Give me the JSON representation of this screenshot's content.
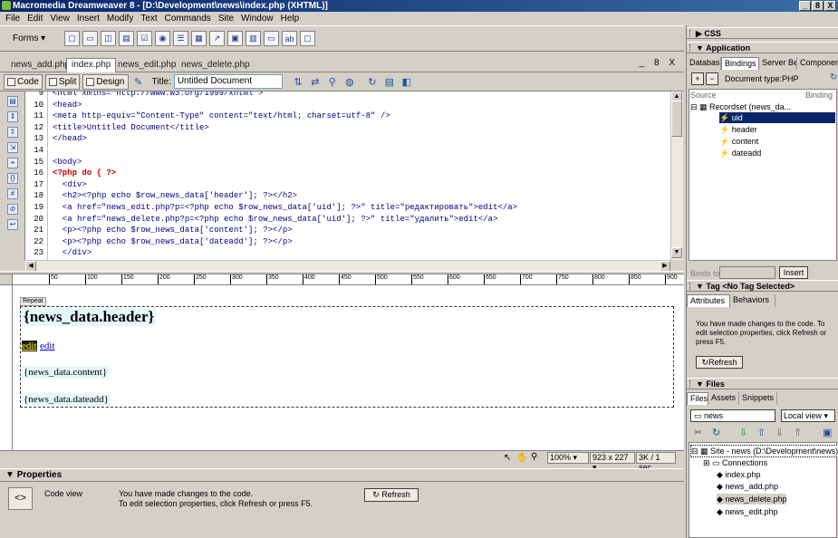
{
  "window": {
    "title": "Macromedia Dreamweaver 8 - [D:\\Development\\news\\index.php (XHTML)]",
    "controls": [
      "_",
      "8",
      "X"
    ]
  },
  "menu": [
    "File",
    "Edit",
    "View",
    "Insert",
    "Modify",
    "Text",
    "Commands",
    "Site",
    "Window",
    "Help"
  ],
  "insert_bar": {
    "category": "Forms"
  },
  "doc_tabs": [
    "news_add.php",
    "index.php",
    "news_edit.php",
    "news_delete.php"
  ],
  "doc_tab_controls": "_ 8 X",
  "doc_toolbar": {
    "code_label": "Code",
    "split_label": "Split",
    "design_label": "Design",
    "title_label": "Title:",
    "title_value": "Untitled Document"
  },
  "code": {
    "line_numbers": [
      "9",
      "10",
      "11",
      "12",
      "13",
      "14",
      "15",
      "16",
      "17",
      "18",
      "19",
      "20",
      "21",
      "22",
      "23"
    ],
    "lines": [
      "<html xmlns=\"http://www.w3.org/1999/xhtml\">",
      "<head>",
      "<meta http-equiv=\"Content-Type\" content=\"text/html; charset=utf-8\" />",
      "<title>Untitled Document</title>",
      "</head>",
      "",
      "<body>",
      "<?php do { ?>",
      "  <div>",
      "  <h2><?php echo $row_news_data['header']; ?></h2>",
      "  <a href=\"news_edit.php?p=<?php echo $row_news_data['uid']; ?>\" title=\"редактировать\">edit</a>",
      "  <a href=\"news_delete.php?p=<?php echo $row_news_data['uid']; ?>\" title=\"удалить\">edit</a>",
      "  <p><?php echo $row_news_data['content']; ?></p>",
      "  <p><?php echo $row_news_data['dateadd']; ?></p>",
      "  </div>"
    ]
  },
  "ruler": [
    "50",
    "100",
    "150",
    "200",
    "250",
    "300",
    "350",
    "400",
    "450",
    "500",
    "550",
    "600",
    "650",
    "700",
    "750",
    "800",
    "850",
    "900"
  ],
  "design": {
    "repeat_label": "Repeat",
    "header": "{news_data.header}",
    "edit1": "edit",
    "edit2": "edit",
    "content": "{news_data.content}",
    "dateadd": "{news_data.dateadd}"
  },
  "status": {
    "zoom": "100%",
    "size": "923 x 227",
    "download": "3K / 1 sec"
  },
  "properties": {
    "title": "Properties",
    "label": "Code view",
    "msg1": "You have made changes to the code.",
    "msg2": "To edit selection properties, click Refresh or press F5.",
    "refresh": "Refresh"
  },
  "panels": {
    "css": "CSS",
    "application": "Application",
    "app_tabs": [
      "Databases",
      "Bindings",
      "Server Be",
      "Componer"
    ],
    "doc_type": "Document type:PHP",
    "source_header": "Source",
    "binding_header": "Binding",
    "recordset": "Recordset (news_da...",
    "fields": [
      "uid",
      "header",
      "content",
      "dateadd"
    ],
    "binds_to": "Binds to:",
    "insert": "Insert",
    "tag_title": "Tag <No Tag Selected>",
    "tag_tabs": [
      "Attributes",
      "Behaviors"
    ],
    "tag_msg": "You have made changes to the code. To edit selection properties, click Refresh or press F5.",
    "tag_refresh": "Refresh",
    "files_title": "Files",
    "files_tabs": [
      "Files",
      "Assets",
      "Snippets"
    ],
    "site": "news",
    "view": "Local view",
    "tree_root": "Site - news (D:\\Development\\news)",
    "tree": [
      "Connections",
      "index.php",
      "news_add.php",
      "news_delete.php",
      "news_edit.php"
    ]
  }
}
